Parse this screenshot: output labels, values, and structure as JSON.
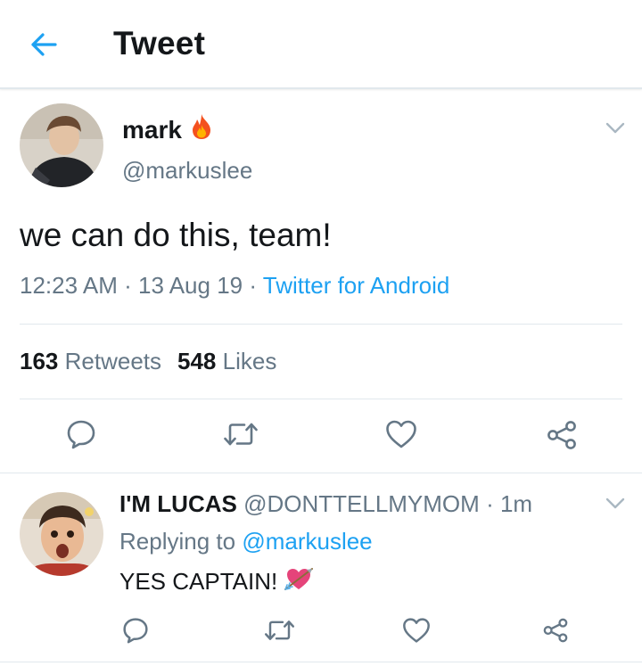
{
  "header": {
    "title": "Tweet"
  },
  "tweet": {
    "name": "mark",
    "handle": "@markuslee",
    "text": "we can do this, team!",
    "time": "12:23 AM",
    "date": "13 Aug 19",
    "sep": "·",
    "source": "Twitter for Android",
    "retweets_count": "163",
    "retweets_label": "Retweets",
    "likes_count": "548",
    "likes_label": "Likes"
  },
  "reply": {
    "name": "I'M LUCAS",
    "handle": "@DONTTELLMYMOM",
    "sep": "·",
    "time": "1m",
    "replying_prefix": "Replying to",
    "replying_handle": "@markuslee",
    "text": "YES CAPTAIN!"
  },
  "colors": {
    "accent": "#1da1f2",
    "secondary_text": "#657786",
    "primary_text": "#14171a",
    "divider": "#e1e8ed",
    "icon": "#657786"
  },
  "icons": {
    "back": "arrow-left-icon",
    "name_emoji": "fire-icon",
    "menu": "chevron-down-icon",
    "reply": "speech-bubble-icon",
    "retweet": "retweet-icon",
    "like": "heart-icon",
    "share": "share-icon",
    "reply_emoji": "heart-with-arrow-icon"
  }
}
